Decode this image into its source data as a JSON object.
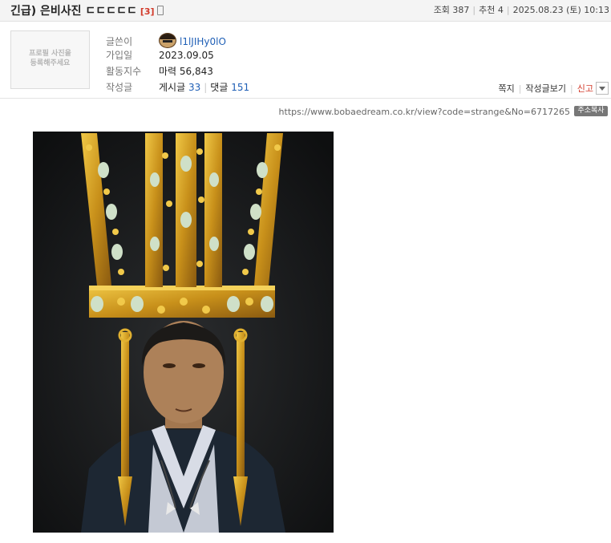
{
  "post": {
    "title": "긴급) 은비사진 ㄷㄷㄷㄷㄷ",
    "comment_count": "[3]"
  },
  "meta": {
    "views": "조회 387",
    "recommend": "추천 4",
    "datetime": "2025.08.23 (토) 10:13"
  },
  "profile": {
    "placeholder_line1": "프로필 사진을",
    "placeholder_line2": "등록해주세요"
  },
  "author": {
    "nick_label": "글쓴이",
    "nickname": "l1lJIHy0lO",
    "join_label": "가입일",
    "join_date": "2023.09.05",
    "activity_label": "활동지수",
    "power_label": "마력",
    "power_value": "56,843",
    "written_label": "작성글",
    "posts_label": "게시글",
    "posts_count": "33",
    "comments_label": "댓글",
    "comments_count": "151"
  },
  "actions": {
    "message": "쪽지",
    "view_posts": "작성글보기",
    "report": "신고"
  },
  "url": {
    "text": "https://www.bobaedream.co.kr/view?code=strange&No=6717265",
    "copy_label": "주소복사"
  },
  "colors": {
    "accent_red": "#d23a2a",
    "link_blue": "#1f5fb6",
    "photo_background": "#1c1e20",
    "gold": "#d4a21e"
  },
  "icons": [
    "mobile-phone-icon",
    "dropdown-arrow-icon"
  ]
}
